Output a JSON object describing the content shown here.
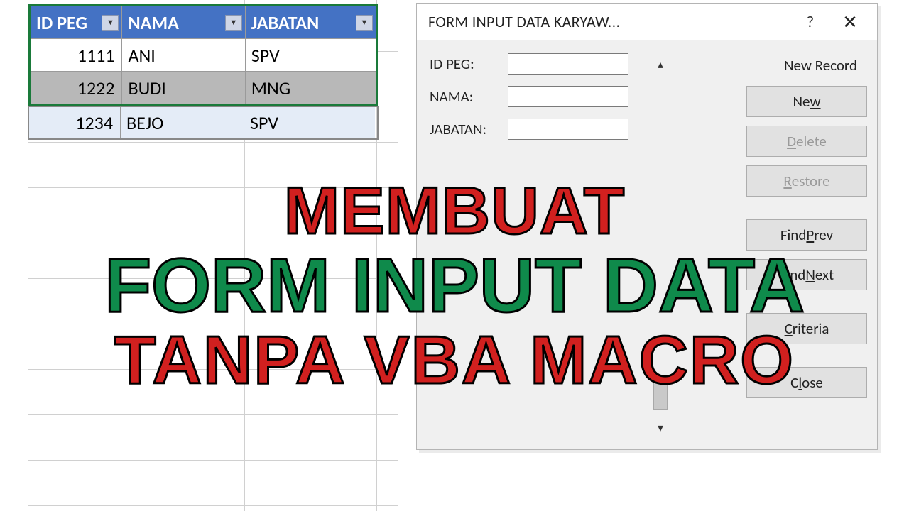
{
  "table": {
    "headers": {
      "id": "ID PEG",
      "nama": "NAMA",
      "jabatan": "JABATAN"
    },
    "rows": [
      {
        "id": "1111",
        "nama": "ANI",
        "jabatan": "SPV"
      },
      {
        "id": "1222",
        "nama": "BUDI",
        "jabatan": "MNG"
      },
      {
        "id": "1234",
        "nama": "BEJO",
        "jabatan": "SPV"
      }
    ]
  },
  "dialog": {
    "title": "FORM INPUT DATA KARYAW...",
    "status": "New Record",
    "fields": {
      "idpeg": {
        "label": "ID PEG:",
        "value": ""
      },
      "nama": {
        "label": "NAMA:",
        "value": ""
      },
      "jabatan": {
        "label": "JABATAN:",
        "value": ""
      }
    },
    "buttons": {
      "new": {
        "pre": "Ne",
        "u": "w",
        "post": ""
      },
      "delete": {
        "pre": "",
        "u": "D",
        "post": "elete"
      },
      "restore": {
        "pre": "",
        "u": "R",
        "post": "estore"
      },
      "findprev": {
        "pre": "Find ",
        "u": "P",
        "post": "rev"
      },
      "findnext": {
        "pre": "Find ",
        "u": "N",
        "post": "ext"
      },
      "criteria": {
        "pre": "",
        "u": "C",
        "post": "riteria"
      },
      "close": {
        "pre": "C",
        "u": "l",
        "post": "ose"
      }
    }
  },
  "headline": {
    "line1": "MEMBUAT",
    "line2": "FORM INPUT DATA",
    "line3": "TANPA VBA MACRO"
  },
  "colors": {
    "table_header_bg": "#4472c4",
    "table_border": "#1a7a3a",
    "headline_red": "#d1201f",
    "headline_green": "#0f8a4b"
  }
}
